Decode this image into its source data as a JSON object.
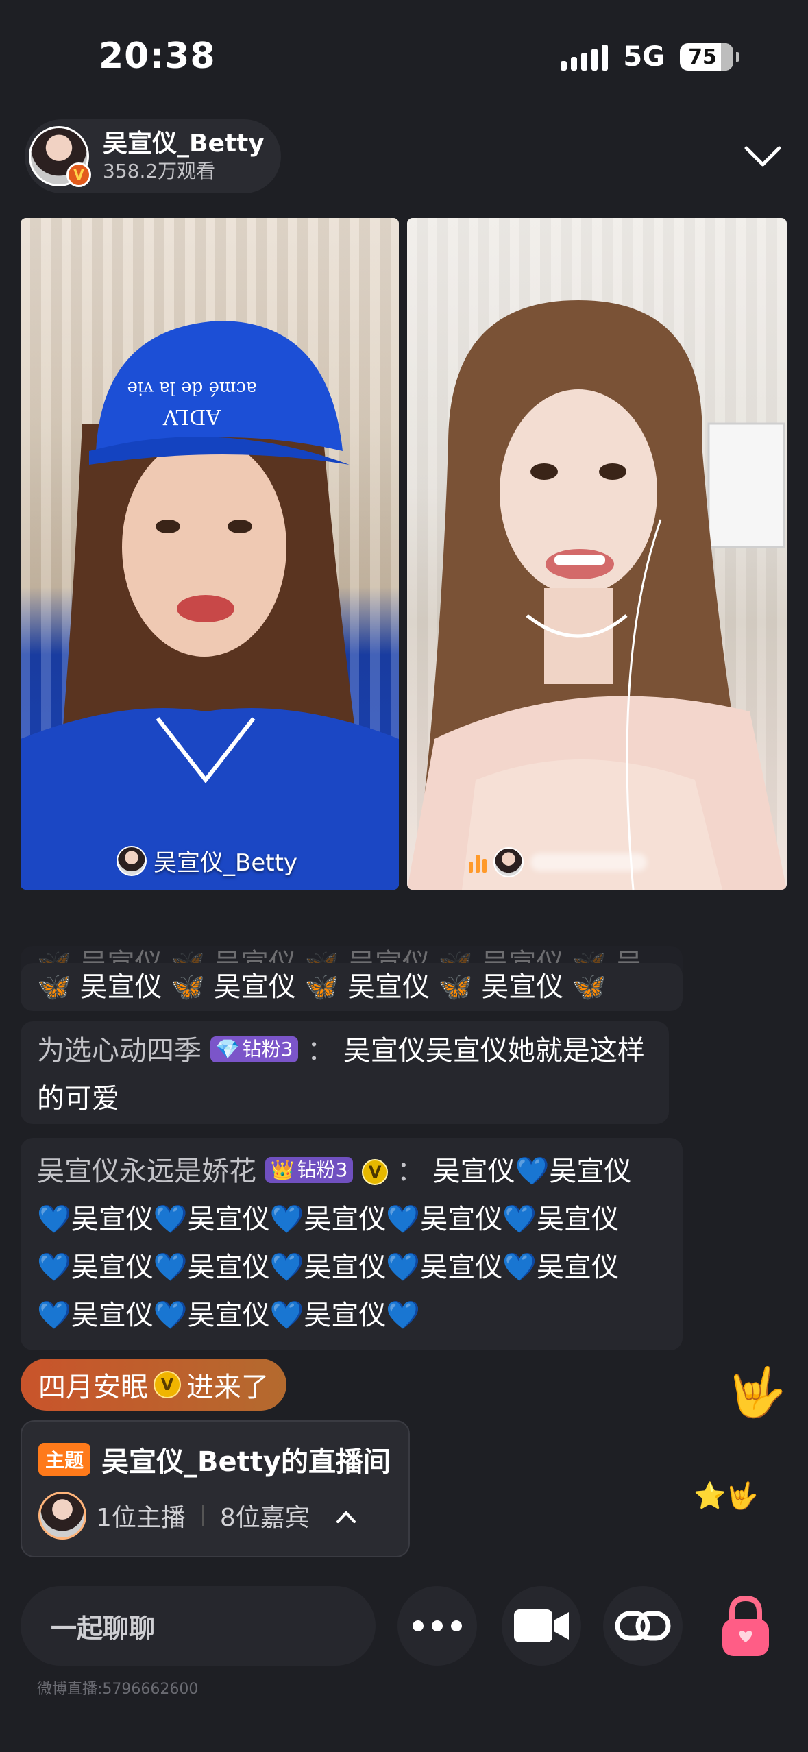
{
  "status_bar": {
    "time": "20:38",
    "network": "5G",
    "battery": "75"
  },
  "host": {
    "name": "吴宣仪_Betty",
    "views": "358.2万观看",
    "badge": "V"
  },
  "tiles": {
    "left_name": "吴宣仪_Betty"
  },
  "comments": [
    {
      "text": "🦋 吴宣仪 🦋 吴宣仪 🦋 吴宣仪 🦋 吴宣仪 🦋 吴宣仪"
    },
    {
      "text": "🦋 吴宣仪 🦋 吴宣仪 🦋 吴宣仪 🦋 吴宣仪 🦋"
    },
    {
      "user": "为选心动四季",
      "badge": "钻粉3",
      "text_line1": "吴宣仪吴宣仪她就是这样",
      "text_line2": "的可爱"
    },
    {
      "user": "吴宣仪永远是娇花",
      "badge": "钻粉3",
      "vmark": "V",
      "text_line1": "吴宣仪💙吴宣仪",
      "text_line2": "💙吴宣仪💙吴宣仪💙吴宣仪💙吴宣仪💙吴宣仪",
      "text_line3": "💙吴宣仪💙吴宣仪💙吴宣仪💙吴宣仪💙吴宣仪",
      "text_line4": "💙吴宣仪💙吴宣仪💙吴宣仪💙"
    }
  ],
  "entry_notice": {
    "user": "四月安眠",
    "vmark": "V",
    "text": "进来了"
  },
  "topic": {
    "tag": "主题",
    "title": "吴宣仪_Betty的直播间",
    "hosts": "1位主播",
    "guests": "8位嘉宾"
  },
  "bottom_bar": {
    "chat_placeholder": "一起聊聊"
  },
  "room_id": "微博直播:5796662600",
  "colors": {
    "background": "#1e1f24",
    "entry_gradient_start": "#c9542b",
    "topic_tag": "#ff7a1a",
    "fan_badge": "#7b55c9"
  },
  "icons": [
    "signal-icon",
    "battery-icon",
    "chevron-down-icon",
    "more-icon",
    "video-camera-icon",
    "link-icon",
    "lock-icon",
    "chevron-up-icon"
  ]
}
